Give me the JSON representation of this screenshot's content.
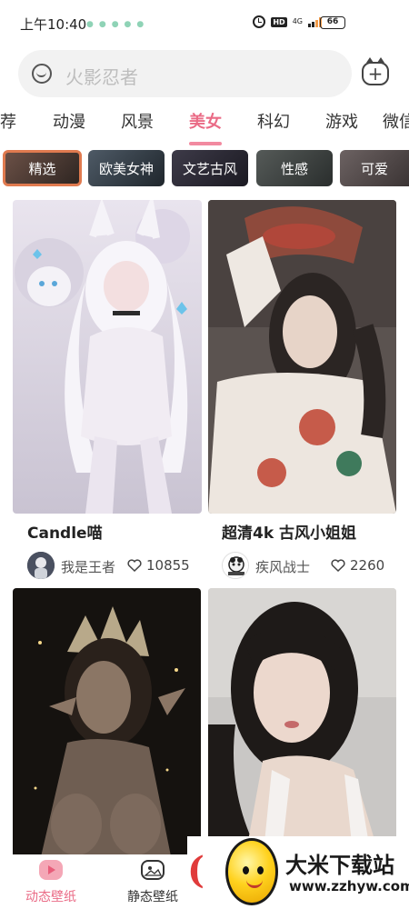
{
  "status_bar": {
    "time": "上午10:40",
    "network": "4G",
    "hd": "HD",
    "battery": "66"
  },
  "search": {
    "placeholder": "火影忍者"
  },
  "tabs": [
    {
      "label": "荐"
    },
    {
      "label": "动漫"
    },
    {
      "label": "风景"
    },
    {
      "label": "美女",
      "active": true
    },
    {
      "label": "科幻"
    },
    {
      "label": "游戏"
    },
    {
      "label": "微信"
    }
  ],
  "chips": [
    {
      "label": "精选",
      "selected": true
    },
    {
      "label": "欧美女神"
    },
    {
      "label": "文艺古风"
    },
    {
      "label": "性感"
    },
    {
      "label": "可爱"
    }
  ],
  "cards": [
    {
      "title": "Candle喵",
      "author": "我是王者",
      "likes": "10855"
    },
    {
      "title": "超清4k 古风小姐姐",
      "author": "疾风战士",
      "likes": "2260"
    },
    {
      "title": "",
      "author": "",
      "likes": ""
    },
    {
      "title": "",
      "author": "",
      "likes": ""
    }
  ],
  "bottom_nav": [
    {
      "label": "动态壁纸",
      "active": true,
      "icon": "play-icon"
    },
    {
      "label": "静态壁纸",
      "icon": "image-icon"
    }
  ],
  "watermark": {
    "title": "大米下载站",
    "url": "www.zzhyw.com"
  },
  "colors": {
    "accent": "#ea6b86",
    "chip_selected_border": "#e07a4f"
  }
}
